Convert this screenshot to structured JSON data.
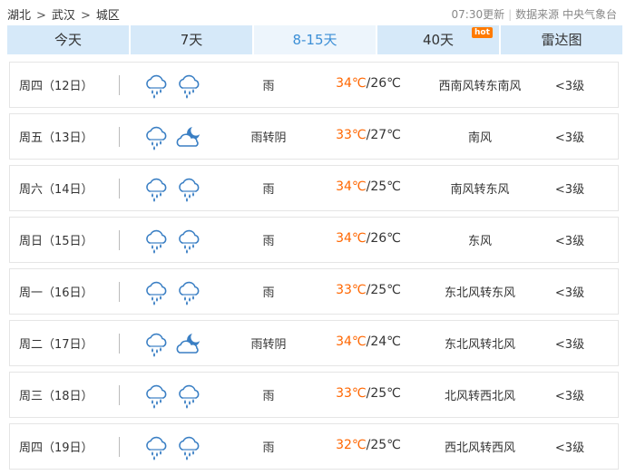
{
  "breadcrumb": {
    "province": "湖北",
    "city": "武汉",
    "district": "城区",
    "separator": ">"
  },
  "source": {
    "updated": "07:30更新",
    "label": "数据来源",
    "provider": "中央气象台"
  },
  "tabs": [
    {
      "label": "今天",
      "active": false
    },
    {
      "label": "7天",
      "active": false
    },
    {
      "label": "8-15天",
      "active": true
    },
    {
      "label": "40天",
      "active": false,
      "badge": "hot"
    },
    {
      "label": "雷达图",
      "active": false
    }
  ],
  "colors": {
    "tab_bg": "#d6e9f9",
    "tab_active_bg": "#edf5fc",
    "tab_active_text": "#3c8fd6",
    "high_temp": "#ff6600",
    "hot_badge": "#ff7a00",
    "icon": "#3a7fc4"
  },
  "forecast": [
    {
      "day": "周四（12日）",
      "icon_day": "rain-cloud-icon",
      "icon_night": "rain-cloud-icon",
      "weather": "雨",
      "high": "34℃",
      "low": "26℃",
      "wind": "西南风转东南风",
      "level": "<3级"
    },
    {
      "day": "周五（13日）",
      "icon_day": "rain-cloud-icon",
      "icon_night": "moon-cloud-icon",
      "weather": "雨转阴",
      "high": "33℃",
      "low": "27℃",
      "wind": "南风",
      "level": "<3级"
    },
    {
      "day": "周六（14日）",
      "icon_day": "rain-cloud-icon",
      "icon_night": "rain-cloud-icon",
      "weather": "雨",
      "high": "34℃",
      "low": "25℃",
      "wind": "南风转东风",
      "level": "<3级"
    },
    {
      "day": "周日（15日）",
      "icon_day": "rain-cloud-icon",
      "icon_night": "rain-cloud-icon",
      "weather": "雨",
      "high": "34℃",
      "low": "26℃",
      "wind": "东风",
      "level": "<3级"
    },
    {
      "day": "周一（16日）",
      "icon_day": "rain-cloud-icon",
      "icon_night": "rain-cloud-icon",
      "weather": "雨",
      "high": "33℃",
      "low": "25℃",
      "wind": "东北风转东风",
      "level": "<3级"
    },
    {
      "day": "周二（17日）",
      "icon_day": "rain-cloud-icon",
      "icon_night": "moon-cloud-icon",
      "weather": "雨转阴",
      "high": "34℃",
      "low": "24℃",
      "wind": "东北风转北风",
      "level": "<3级"
    },
    {
      "day": "周三（18日）",
      "icon_day": "rain-cloud-icon",
      "icon_night": "rain-cloud-icon",
      "weather": "雨",
      "high": "33℃",
      "low": "25℃",
      "wind": "北风转西北风",
      "level": "<3级"
    },
    {
      "day": "周四（19日）",
      "icon_day": "rain-cloud-icon",
      "icon_night": "rain-cloud-icon",
      "weather": "雨",
      "high": "32℃",
      "low": "25℃",
      "wind": "西北风转西风",
      "level": "<3级"
    }
  ]
}
